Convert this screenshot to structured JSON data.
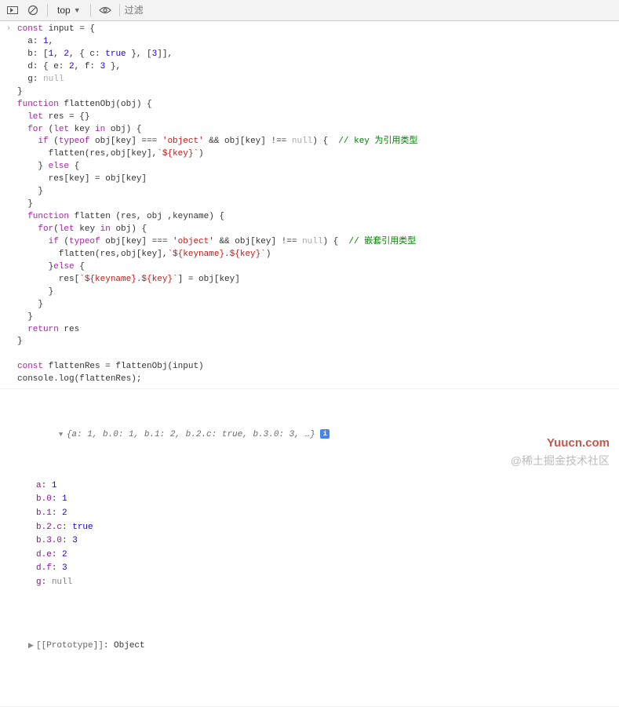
{
  "toolbar": {
    "context": "top",
    "filter_placeholder": "过滤"
  },
  "code": "const input = {\n  a: 1,\n  b: [1, 2, { c: true }, [3]],\n  d: { e: 2, f: 3 },\n  g: null\n}\nfunction flattenObj(obj) {\n  let res = {}\n  for (let key in obj) {\n    if (typeof obj[key] === 'object' && obj[key] !== null) {  // key 为引用类型\n      flatten(res,obj[key],`${key}`)\n    } else {\n      res[key] = obj[key]\n    }\n  }\n  function flatten (res, obj ,keyname) {\n    for(let key in obj) {\n      if (typeof obj[key] === 'object' && obj[key] !== null) {  // 嵌套引用类型\n        flatten(res,obj[key],`${keyname}.${key}`)\n      }else {\n        res[`${keyname}.${key}`] = obj[key]\n      }\n    }\n  }\n  return res\n}\n\nconst flattenRes = flattenObj(input)\nconsole.log(flattenRes);",
  "output": {
    "summary": "{a: 1, b.0: 1, b.1: 2, b.2.c: true, b.3.0: 3, …}",
    "props": [
      {
        "k": "a",
        "v": "1",
        "t": "num"
      },
      {
        "k": "b.0",
        "v": "1",
        "t": "num"
      },
      {
        "k": "b.1",
        "v": "2",
        "t": "num"
      },
      {
        "k": "b.2.c",
        "v": "true",
        "t": "bool"
      },
      {
        "k": "b.3.0",
        "v": "3",
        "t": "num"
      },
      {
        "k": "d.e",
        "v": "2",
        "t": "num"
      },
      {
        "k": "d.f",
        "v": "3",
        "t": "num"
      },
      {
        "k": "g",
        "v": "null",
        "t": "null"
      }
    ],
    "proto_label": "[[Prototype]]",
    "proto_value": "Object"
  },
  "watermark1": "Yuucn.com",
  "watermark2": "@稀土掘金技术社区"
}
